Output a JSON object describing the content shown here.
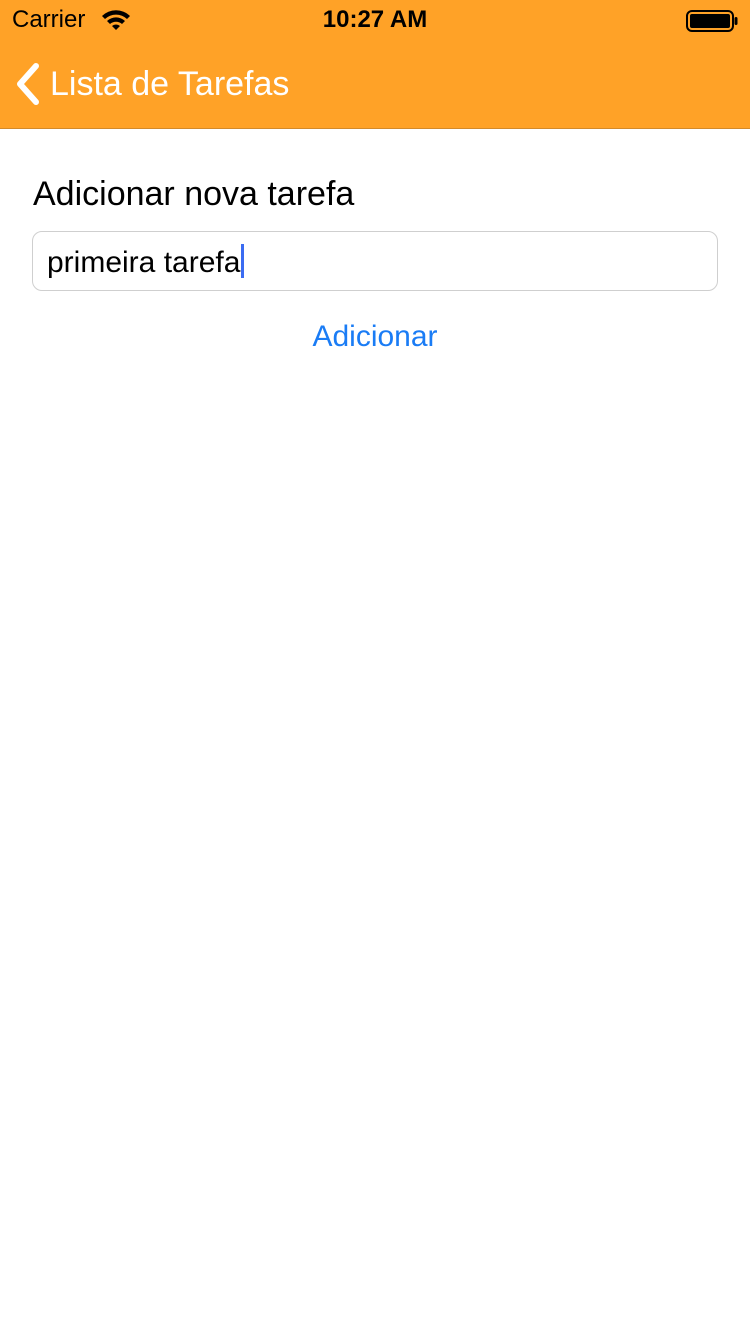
{
  "status_bar": {
    "carrier": "Carrier",
    "time": "10:27 AM",
    "wifi_icon": "wifi-icon",
    "battery_icon": "battery-icon"
  },
  "nav": {
    "back_label": "Lista de Tarefas",
    "back_icon": "chevron-left-icon",
    "bar_color": "#FFA227"
  },
  "form": {
    "title": "Adicionar nova tarefa",
    "input_value": "primeira tarefa",
    "add_label": "Adicionar",
    "accent_color": "#1a7cf5"
  }
}
